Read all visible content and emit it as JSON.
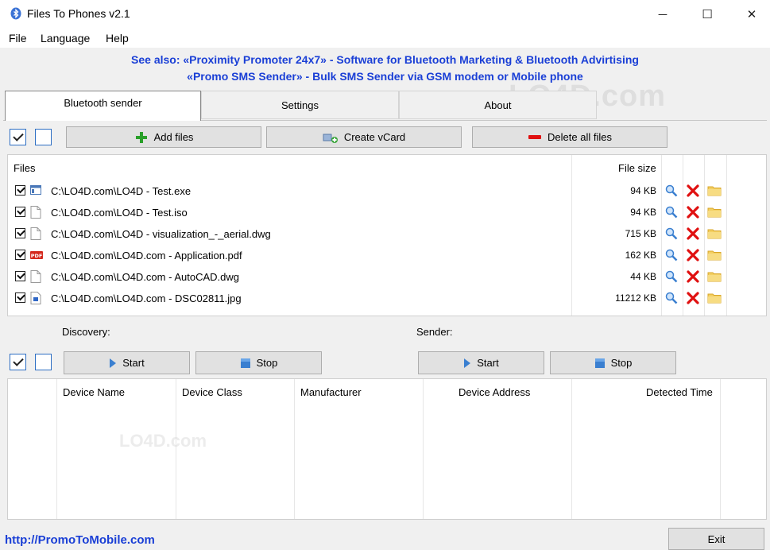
{
  "window": {
    "title": "Files To Phones v2.1",
    "controls": {
      "minimize": "─",
      "maximize": "☐",
      "close": "✕"
    }
  },
  "menu": [
    "File",
    "Language",
    "Help"
  ],
  "promo": {
    "line1": "See also: «Proximity Promoter 24x7» - Software for Bluetooth Marketing & Bluetooth Advirtising",
    "line2": "«Promo SMS Sender» - Bulk SMS Sender via GSM modem or Mobile phone"
  },
  "tabs": [
    {
      "label": "Bluetooth sender",
      "active": true
    },
    {
      "label": "Settings",
      "active": false
    },
    {
      "label": "About",
      "active": false
    }
  ],
  "toolbar": {
    "check_all": true,
    "uncheck_all": false,
    "add_files": "Add files",
    "create_vcard": "Create vCard",
    "delete_all": "Delete all files"
  },
  "files": {
    "header_files": "Files",
    "header_size": "File size",
    "rows": [
      {
        "checked": true,
        "name": "C:\\LO4D.com\\LO4D - Test.exe",
        "size": "94 KB",
        "icon": "exe-icon"
      },
      {
        "checked": true,
        "name": "C:\\LO4D.com\\LO4D - Test.iso",
        "size": "94 KB",
        "icon": "blank-file-icon"
      },
      {
        "checked": true,
        "name": "C:\\LO4D.com\\LO4D - visualization_-_aerial.dwg",
        "size": "715 KB",
        "icon": "blank-file-icon"
      },
      {
        "checked": true,
        "name": "C:\\LO4D.com\\LO4D.com - Application.pdf",
        "size": "162 KB",
        "icon": "pdf-icon"
      },
      {
        "checked": true,
        "name": "C:\\LO4D.com\\LO4D.com - AutoCAD.dwg",
        "size": "44 KB",
        "icon": "blank-file-icon"
      },
      {
        "checked": true,
        "name": "C:\\LO4D.com\\LO4D.com - DSC02811.jpg",
        "size": "11212 KB",
        "icon": "image-file-icon"
      }
    ]
  },
  "discovery": {
    "label": "Discovery:",
    "start": "Start",
    "stop": "Stop",
    "check_all": true,
    "uncheck_all": false
  },
  "sender": {
    "label": "Sender:",
    "start": "Start",
    "stop": "Stop"
  },
  "devices": {
    "columns": [
      "Device Name",
      "Device Class",
      "Manufacturer",
      "Device Address",
      "Detected Time"
    ],
    "rows": []
  },
  "footer": {
    "link": "http://PromoToMobile.com",
    "exit": "Exit"
  },
  "watermark": {
    "main": "LO4D.com",
    "small": "LO4D.com"
  },
  "colors": {
    "link_blue": "#1a3fd6",
    "delete_red": "#e01010",
    "add_green": "#2aa02a",
    "control_blue": "#2d6ec3"
  }
}
